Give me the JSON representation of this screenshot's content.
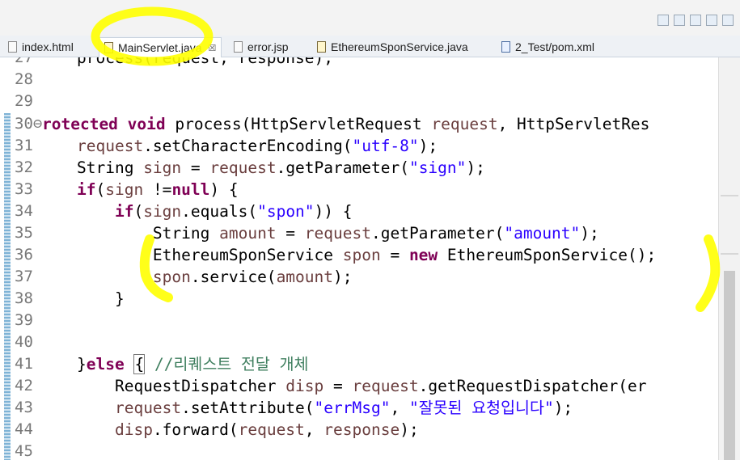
{
  "toolbar": {
    "icons": [
      "perspective-icon",
      "layout-icon",
      "java-perspective-icon",
      "debug-icon",
      "git-icon"
    ]
  },
  "tabs": [
    {
      "label": "index.html",
      "icon": "html-file-icon",
      "active": false
    },
    {
      "label": "MainServlet.java",
      "icon": "java-file-icon",
      "active": true,
      "close": "☒"
    },
    {
      "label": "error.jsp",
      "icon": "jsp-file-icon",
      "active": false
    },
    {
      "label": "EthereumSponService.java",
      "icon": "java-file-icon",
      "active": false
    },
    {
      "label": "2_Test/pom.xml",
      "icon": "maven-file-icon",
      "active": false
    }
  ],
  "editor": {
    "lines": [
      {
        "n": "27",
        "code": "process(request, response);"
      },
      {
        "n": "28",
        "code": ""
      },
      {
        "n": "29",
        "code": ""
      },
      {
        "n": "30⊖",
        "code": "rotected void process(HttpServletRequest request, HttpServletRes"
      },
      {
        "n": "31",
        "code": "request.setCharacterEncoding(\"utf-8\");"
      },
      {
        "n": "32",
        "code": "String sign = request.getParameter(\"sign\");"
      },
      {
        "n": "33",
        "code": "if(sign !=null) {"
      },
      {
        "n": "34",
        "code": "    if(sign.equals(\"spon\")) {"
      },
      {
        "n": "35",
        "code": "        String amount = request.getParameter(\"amount\");"
      },
      {
        "n": "36",
        "code": "        EthereumSponService spon = new EthereumSponService();"
      },
      {
        "n": "37",
        "code": "        spon.service(amount);"
      },
      {
        "n": "38",
        "code": "    }"
      },
      {
        "n": "39",
        "code": ""
      },
      {
        "n": "40",
        "code": ""
      },
      {
        "n": "41",
        "code": "}else { //리퀘스트 전달 개체"
      },
      {
        "n": "42",
        "code": "    RequestDispatcher disp = request.getRequestDispatcher(\"er"
      },
      {
        "n": "43",
        "code": "    request.setAttribute(\"errMsg\", \"잘못된 요청입니다\");"
      },
      {
        "n": "44",
        "code": "    disp.forward(request, response);"
      },
      {
        "n": "45",
        "code": ""
      }
    ]
  },
  "colors": {
    "keyword": "#7f0055",
    "string": "#2a00ff",
    "variable": "#6a3e3e",
    "comment": "#3f7f5f",
    "highlighter": "#ffff00"
  }
}
